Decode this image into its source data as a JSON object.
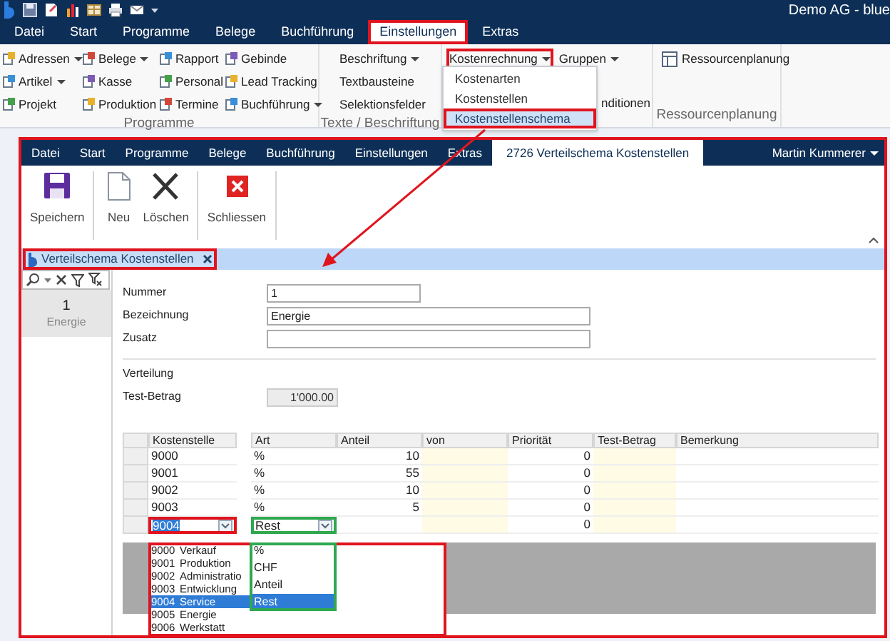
{
  "title_bar": {
    "title": "Demo AG - blue"
  },
  "menu_tabs": [
    {
      "label": "Datei",
      "selected": false,
      "highlighted": false
    },
    {
      "label": "Start",
      "selected": false,
      "highlighted": false
    },
    {
      "label": "Programme",
      "selected": false,
      "highlighted": false
    },
    {
      "label": "Belege",
      "selected": false,
      "highlighted": false
    },
    {
      "label": "Buchführung",
      "selected": false,
      "highlighted": false
    },
    {
      "label": "Einstellungen",
      "selected": true,
      "highlighted": true
    },
    {
      "label": "Extras",
      "selected": false,
      "highlighted": false
    }
  ],
  "ribbon": {
    "programme": {
      "label": "Programme",
      "columns": [
        {
          "items": [
            {
              "label": "Adressen",
              "dropdown": true
            },
            {
              "label": "Artikel",
              "dropdown": true
            },
            {
              "label": "Projekt",
              "dropdown": false
            }
          ]
        },
        {
          "items": [
            {
              "label": "Belege",
              "dropdown": true
            },
            {
              "label": "Kasse",
              "dropdown": false
            },
            {
              "label": "Produktion",
              "dropdown": false
            }
          ]
        },
        {
          "items": [
            {
              "label": "Rapport",
              "dropdown": false
            },
            {
              "label": "Personal",
              "dropdown": false
            },
            {
              "label": "Termine",
              "dropdown": false
            }
          ]
        },
        {
          "items": [
            {
              "label": "Gebinde",
              "dropdown": false
            },
            {
              "label": "Lead Tracking",
              "dropdown": false
            },
            {
              "label": "Buchführung",
              "dropdown": true
            }
          ]
        }
      ]
    },
    "texte": {
      "label": "Texte / Beschriftung",
      "items": [
        {
          "label": "Beschriftung",
          "dropdown": true
        },
        {
          "label": "Textbausteine",
          "dropdown": false
        },
        {
          "label": "Selektionsfelder",
          "dropdown": false
        }
      ]
    },
    "kosten": {
      "items": [
        {
          "label": "Kostenrechnung",
          "dropdown": true,
          "highlighted": true
        },
        {
          "label": "Gruppen",
          "dropdown": true,
          "highlighted": false
        }
      ],
      "partial_item": "nditionen"
    },
    "ressourcen": {
      "label": "Ressourcenplanung",
      "item": "Ressourcenplanung"
    }
  },
  "kostenrechnung_menu": [
    {
      "label": "Kostenarten",
      "selected": false,
      "highlighted": false
    },
    {
      "label": "Kostenstellen",
      "selected": false,
      "highlighted": false
    },
    {
      "label": "Kostenstellenschema",
      "selected": true,
      "highlighted": true
    }
  ],
  "inner_window": {
    "tabs": [
      {
        "label": "Datei",
        "selected": false
      },
      {
        "label": "Start",
        "selected": false
      },
      {
        "label": "Programme",
        "selected": false
      },
      {
        "label": "Belege",
        "selected": false
      },
      {
        "label": "Buchführung",
        "selected": false
      },
      {
        "label": "Einstellungen",
        "selected": false
      },
      {
        "label": "Extras",
        "selected": false
      },
      {
        "label": "2726 Verteilschema Kostenstellen",
        "selected": true
      }
    ],
    "user": "Martin Kummerer",
    "toolbar": [
      {
        "kind": "save",
        "label": "Speichern"
      },
      {
        "kind": "separator"
      },
      {
        "kind": "new",
        "label": "Neu"
      },
      {
        "kind": "delete",
        "label": "Löschen"
      },
      {
        "kind": "separator"
      },
      {
        "kind": "close",
        "label": "Schliessen"
      },
      {
        "kind": "separator"
      }
    ],
    "document_tab": {
      "label": "Verteilschema Kostenstellen",
      "highlighted": true
    },
    "list": [
      {
        "number": "1",
        "name": "Energie",
        "selected": true
      }
    ],
    "form": {
      "fields": [
        {
          "label": "Nummer",
          "value": "1"
        },
        {
          "label": "Bezeichnung",
          "value": "Energie"
        },
        {
          "label": "Zusatz"
        }
      ],
      "section": "Verteilung",
      "test_betrag": {
        "label": "Test-Betrag",
        "value": "1'000.00"
      }
    },
    "grid": {
      "columns": [
        {
          "label": "Kostenstelle",
          "shaded": false
        },
        {
          "label": "Art",
          "shaded": false
        },
        {
          "label": "Anteil",
          "shaded": false
        },
        {
          "label": "von",
          "shaded": true
        },
        {
          "label": "Priorität",
          "shaded": false
        },
        {
          "label": "Test-Betrag",
          "shaded": true
        },
        {
          "label": "Bemerkung",
          "shaded": false
        }
      ],
      "rows": [
        {
          "kind": "row",
          "cells": [
            "9000",
            "%",
            "10",
            "",
            "0",
            "",
            ""
          ]
        },
        {
          "kind": "row",
          "cells": [
            "9001",
            "%",
            "55",
            "",
            "0",
            "",
            ""
          ]
        },
        {
          "kind": "row",
          "cells": [
            "9002",
            "%",
            "10",
            "",
            "0",
            "",
            ""
          ]
        },
        {
          "kind": "row",
          "cells": [
            "9003",
            "%",
            "5",
            "",
            "0",
            "",
            ""
          ]
        },
        {
          "kind": "edit",
          "cells": [
            "9004",
            "Rest",
            "",
            "",
            "0",
            "",
            ""
          ]
        }
      ]
    },
    "kostenstelle_list": {
      "color": "#e0141e",
      "items": [
        {
          "code": "9000",
          "name": "Verkauf",
          "selected": false
        },
        {
          "code": "9001",
          "name": "Produktion",
          "selected": false
        },
        {
          "code": "9002",
          "name": "Administratio",
          "selected": false
        },
        {
          "code": "9003",
          "name": "Entwicklung",
          "selected": false
        },
        {
          "code": "9004",
          "name": "Service",
          "selected": true
        },
        {
          "code": "9005",
          "name": "Energie",
          "selected": false
        },
        {
          "code": "9006",
          "name": "Werkstatt",
          "selected": false
        }
      ]
    },
    "art_list": {
      "color": "#2fa84f",
      "items": [
        {
          "label": "%",
          "selected": false
        },
        {
          "label": "CHF",
          "selected": false
        },
        {
          "label": "Anteil",
          "selected": false
        },
        {
          "label": "Rest",
          "selected": true
        }
      ]
    }
  }
}
